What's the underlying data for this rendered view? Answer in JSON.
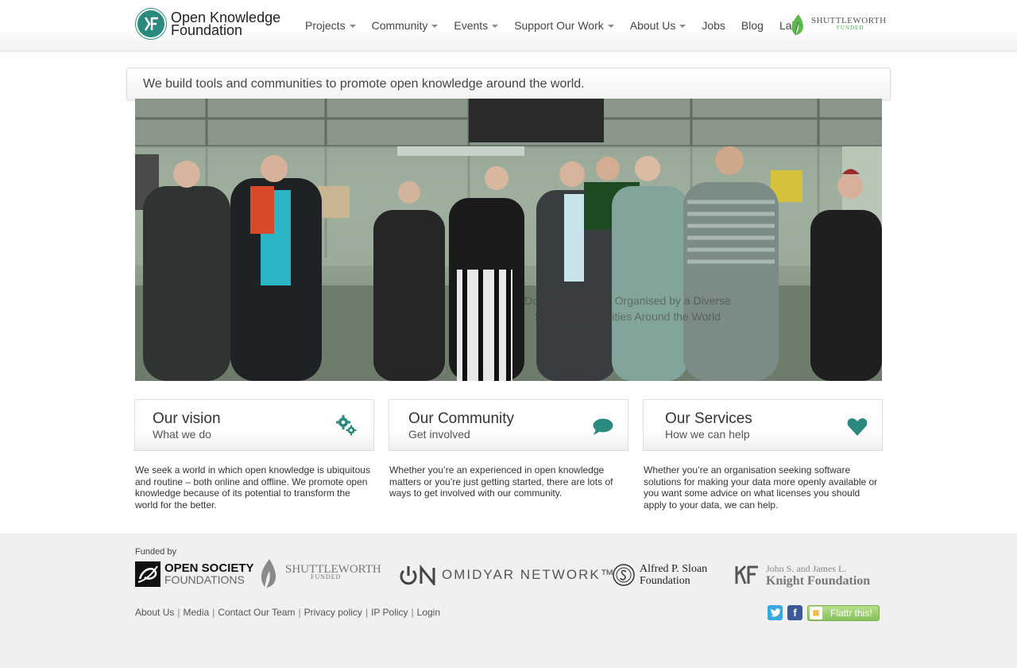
{
  "header": {
    "logo_line1": "Open Knowledge",
    "logo_line2": "Foundation",
    "nav": [
      {
        "label": "Projects",
        "dropdown": true
      },
      {
        "label": "Community",
        "dropdown": true
      },
      {
        "label": "Events",
        "dropdown": true
      },
      {
        "label": "Support Our Work",
        "dropdown": true
      },
      {
        "label": "About Us",
        "dropdown": true
      },
      {
        "label": "Jobs",
        "dropdown": false
      },
      {
        "label": "Blog",
        "dropdown": false
      },
      {
        "label": "Labs",
        "dropdown": false
      }
    ],
    "shuttleworth_name": "SHUTTLEWORTH",
    "shuttleworth_funded": "FUNDED"
  },
  "tagline": "We build tools and communities to promote open knowledge around the world.",
  "hero": {
    "caption_line1": "Dozens of Events Organised by a Diverse",
    "caption_line2": "Set of Communities Around the World"
  },
  "boxes": [
    {
      "title": "Our vision",
      "subtitle": "What we do",
      "icon": "gears-icon",
      "text": "We seek a world in which open knowledge is ubiquitous and routine – both online and offline. We promote open knowledge because of its potential to transform the world for the better."
    },
    {
      "title": "Our Community",
      "subtitle": "Get involved",
      "icon": "speech-bubble-icon",
      "text": "Whether you’re an experienced in open knowledge matters or you’re just getting started, there are lots of ways to get involved with our community."
    },
    {
      "title": "Our Services",
      "subtitle": "How we can help",
      "icon": "heart-icon",
      "text": "Whether you’re an organisation seeking software solutions for making your data more openly available or you want some advice on what licenses you should apply to your data, we can help."
    }
  ],
  "footer": {
    "funded_by": "Funded by",
    "funders": {
      "osf_line1": "OPEN SOCIETY",
      "osf_line2": "FOUNDATIONS",
      "sw_line1": "SHUTTLEWORTH",
      "sw_line2": "FUNDED",
      "omidyar": "OMIDYAR NETWORK™",
      "sloan_line1": "Alfred P. Sloan",
      "sloan_line2": "Foundation",
      "knight_line1": "John S. and James L.",
      "knight_line2": "Knight Foundation"
    },
    "links": [
      "About Us",
      "Media",
      "Contact Our Team",
      "Privacy policy",
      "IP Policy",
      "Login"
    ],
    "flattr": "Flattr this!"
  },
  "colors": {
    "accent": "#2b8a7e",
    "footer_bg": "#f0f0f0",
    "twitter": "#3aa7e0",
    "facebook": "#3b5998",
    "flattr": "#87c15b"
  }
}
